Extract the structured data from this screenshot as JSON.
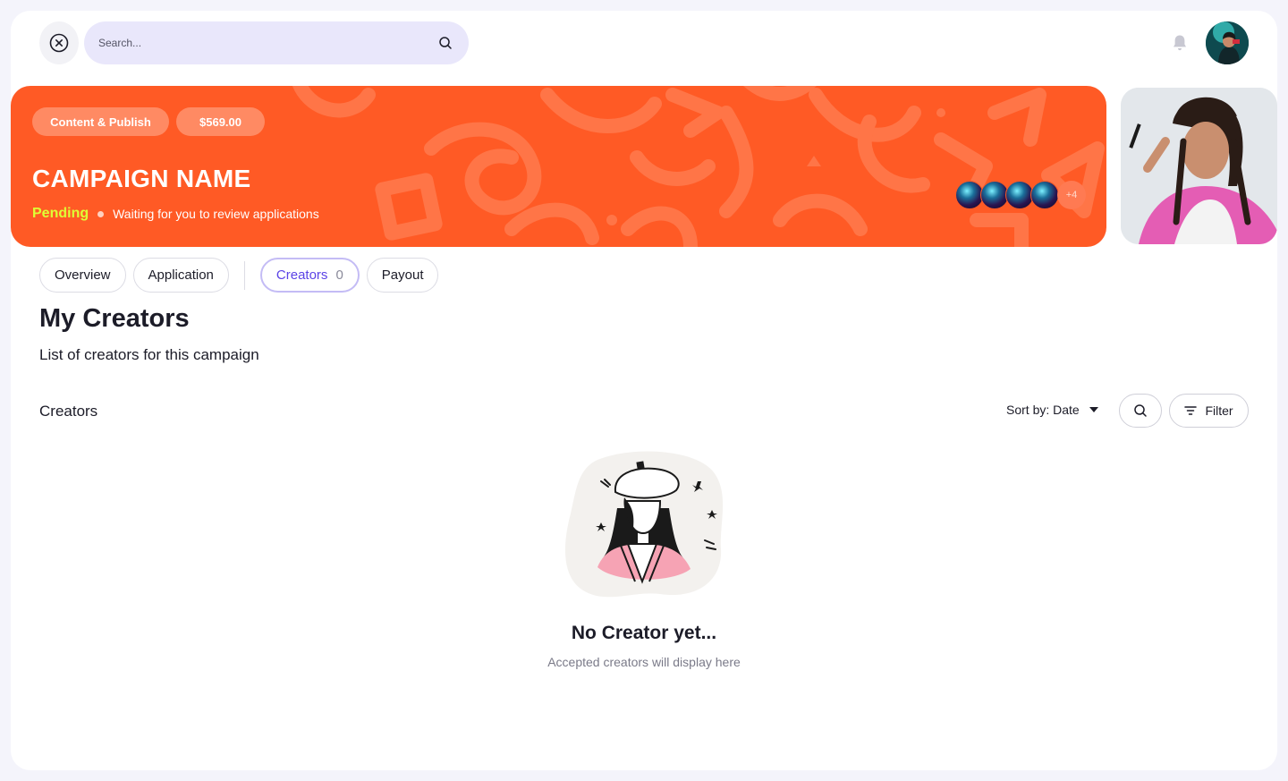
{
  "search": {
    "placeholder": "Search..."
  },
  "banner": {
    "chips": [
      "Content & Publish",
      "$569.00"
    ],
    "title": "CAMPAIGN NAME",
    "status": "Pending",
    "status_text": "Waiting for you to review applications",
    "extra_avatars": "+4",
    "accent_color": "#ff5a25",
    "status_color": "#dfff35"
  },
  "tabs": [
    {
      "label": "Overview"
    },
    {
      "label": "Application"
    },
    {
      "label": "Creators",
      "count": "0",
      "active": true
    },
    {
      "label": "Payout"
    }
  ],
  "page": {
    "title": "My Creators",
    "subtitle": "List of  creators for this campaign"
  },
  "list": {
    "label": "Creators",
    "sort_label": "Sort by: Date",
    "filter_label": "Filter"
  },
  "empty": {
    "title": "No Creator yet...",
    "subtitle": "Accepted creators will display here"
  },
  "icons": {
    "close": "close-icon",
    "search": "search-icon",
    "bell": "bell-icon",
    "sort": "caret-down-icon",
    "filter": "filter-icon"
  }
}
